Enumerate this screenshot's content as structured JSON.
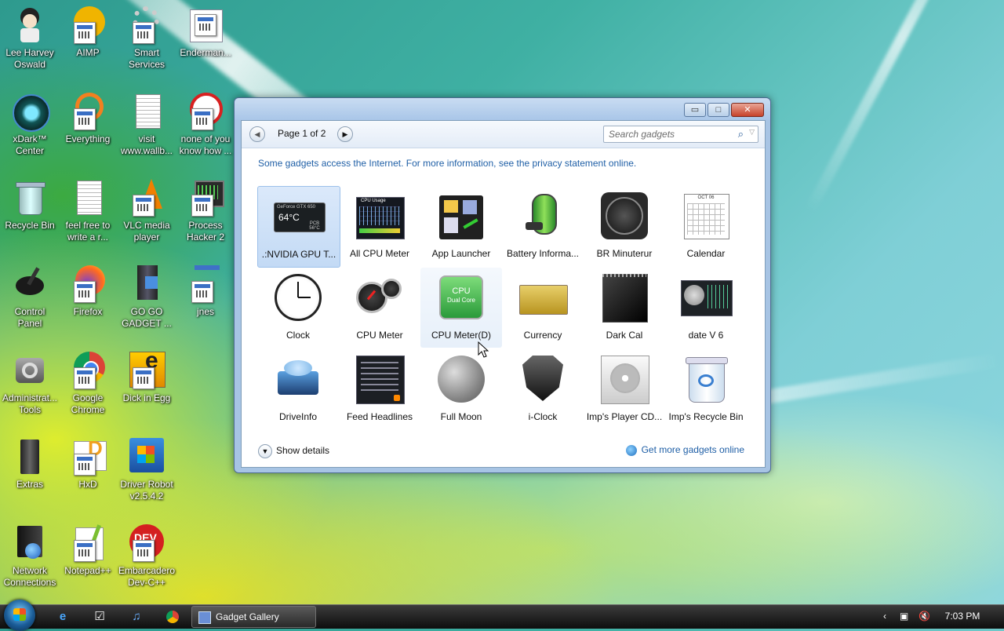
{
  "desktop": {
    "icons": [
      {
        "label": "Lee Harvey\nOswald"
      },
      {
        "label": "AIMP"
      },
      {
        "label": "Smart\nServices"
      },
      {
        "label": "Enderman..."
      },
      {
        "label": "xDark™\nCenter"
      },
      {
        "label": "Everything"
      },
      {
        "label": "visit\nwww.wallb..."
      },
      {
        "label": "none of you\nknow how ..."
      },
      {
        "label": "Recycle Bin"
      },
      {
        "label": "feel free to\nwrite a r..."
      },
      {
        "label": "VLC media\nplayer"
      },
      {
        "label": "Process\nHacker 2"
      },
      {
        "label": "Control\nPanel"
      },
      {
        "label": "Firefox"
      },
      {
        "label": "GO GO\nGADGET ..."
      },
      {
        "label": "jnes"
      },
      {
        "label": "Administrat...\nTools"
      },
      {
        "label": "Google\nChrome"
      },
      {
        "label": "Dick in Egg"
      },
      {
        "label": "Extras"
      },
      {
        "label": "HxD"
      },
      {
        "label": "Driver Robot\nv2.5.4.2"
      },
      {
        "label": "Network\nConnections"
      },
      {
        "label": "Notepad++"
      },
      {
        "label": "Embarcadero\nDev-C++"
      }
    ]
  },
  "gallery": {
    "page_label": "Page 1 of 2",
    "search_placeholder": "Search gadgets",
    "privacy_text": "Some gadgets access the Internet.  For more information, see the privacy statement online.",
    "gadgets": [
      {
        "label": ".:NVIDIA GPU T..."
      },
      {
        "label": "All CPU Meter"
      },
      {
        "label": "App Launcher"
      },
      {
        "label": "Battery Informa..."
      },
      {
        "label": "BR Minuterur"
      },
      {
        "label": "Calendar"
      },
      {
        "label": "Clock"
      },
      {
        "label": "CPU Meter"
      },
      {
        "label": "CPU Meter(D)"
      },
      {
        "label": "Currency"
      },
      {
        "label": "Dark Cal"
      },
      {
        "label": "date V 6"
      },
      {
        "label": "DriveInfo"
      },
      {
        "label": "Feed Headlines"
      },
      {
        "label": "Full Moon"
      },
      {
        "label": "i-Clock"
      },
      {
        "label": "Imp's Player CD..."
      },
      {
        "label": "Imp's Recycle Bin"
      }
    ],
    "thumb_text": {
      "gpu": "GeForce GTX 650",
      "gpu_temp": "64°C",
      "gpu_pcb": "PCB 56°C",
      "cpu_usage": "CPU Usage",
      "cpu_dual": "CPU",
      "cpu_dual_sub": "Dual Core",
      "calendar_month": "OCT 06"
    },
    "show_details": "Show details",
    "get_more": "Get more gadgets online"
  },
  "taskbar": {
    "task_label": "Gadget Gallery",
    "clock": "7:03 PM"
  }
}
